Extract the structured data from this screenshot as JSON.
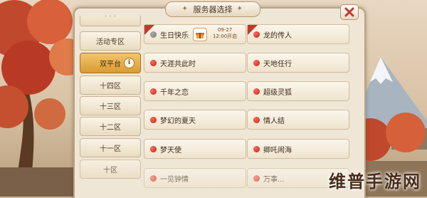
{
  "dialog": {
    "title": "服务器选择",
    "close_icon": "close-icon"
  },
  "sidebar": {
    "items": [
      {
        "label": "活动专区"
      },
      {
        "label": "双平台",
        "active": true
      },
      {
        "label": "十四区"
      },
      {
        "label": "十三区"
      },
      {
        "label": "十二区"
      },
      {
        "label": "十一区"
      },
      {
        "label": "十区"
      }
    ]
  },
  "servers": {
    "left": [
      {
        "name": "生日快乐",
        "gift_date": "09-27",
        "gift_time": "12:00开启"
      },
      {
        "name": "天涯共此时"
      },
      {
        "name": "千年之恋"
      },
      {
        "name": "梦幻的夏天"
      },
      {
        "name": "梦天使"
      },
      {
        "name": "一见钟情"
      }
    ],
    "right": [
      {
        "name": "龙的传人"
      },
      {
        "name": "天地任行"
      },
      {
        "name": "超级灵狐"
      },
      {
        "name": "情人结"
      },
      {
        "name": "卿吒闹海"
      },
      {
        "name": "万事..."
      }
    ]
  },
  "watermark": "维普手游网",
  "colors": {
    "accent": "#d89b35",
    "status_dot": "#c41e14",
    "close_x": "#c0392b"
  }
}
